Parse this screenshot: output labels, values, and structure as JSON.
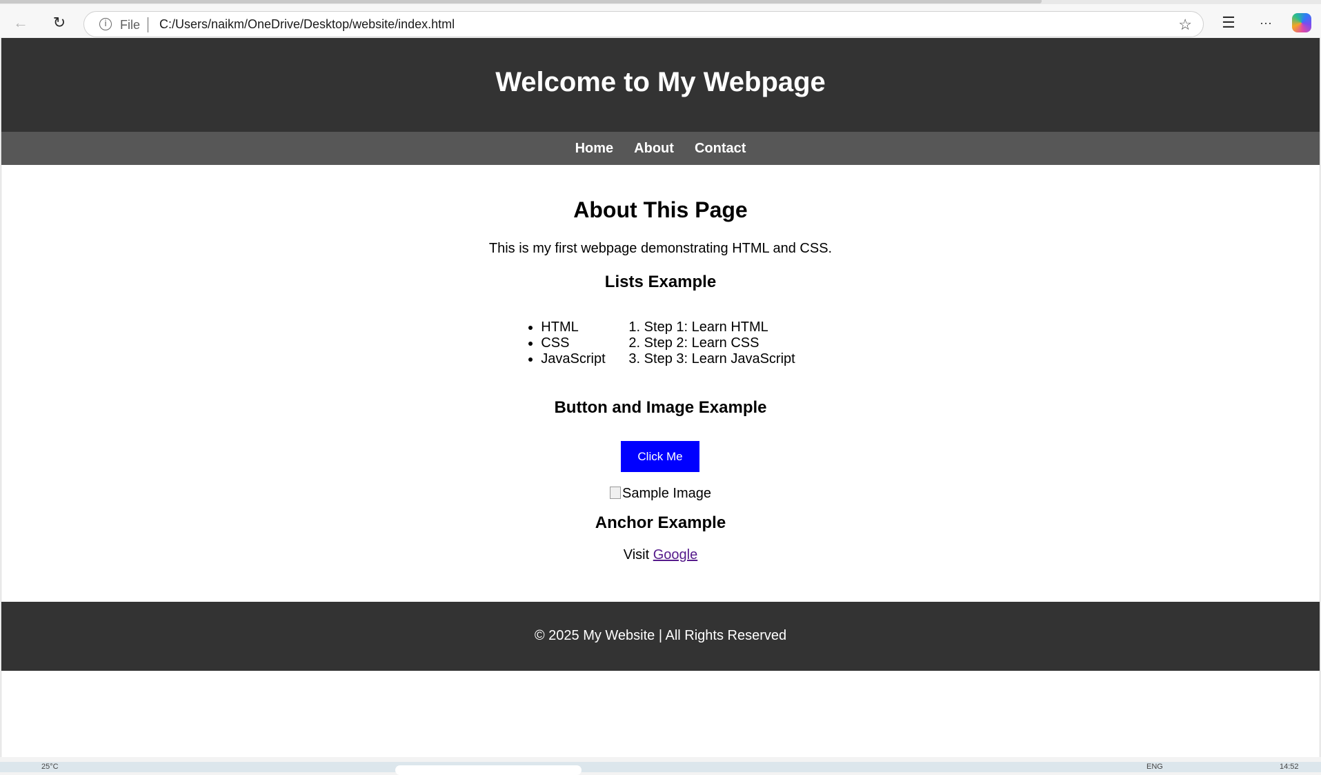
{
  "browser": {
    "address_scheme": "File",
    "address_url": "C:/Users/naikm/OneDrive/Desktop/website/index.html",
    "info_icon_char": "i",
    "back_icon": "←",
    "refresh_icon": "↻",
    "star_icon": "☆",
    "favorites_icon": "☰",
    "more_icon": "···"
  },
  "page": {
    "header_title": "Welcome to My Webpage",
    "nav": [
      {
        "label": "Home"
      },
      {
        "label": "About"
      },
      {
        "label": "Contact"
      }
    ],
    "about_heading": "About This Page",
    "intro_text": "This is my first webpage demonstrating HTML and CSS.",
    "lists_heading": "Lists Example",
    "unordered_list": [
      "HTML",
      "CSS",
      "JavaScript"
    ],
    "ordered_list": [
      "Step 1: Learn HTML",
      "Step 2: Learn CSS",
      "Step 3: Learn JavaScript"
    ],
    "button_image_heading": "Button and Image Example",
    "button_label": "Click Me",
    "image_alt": "Sample Image",
    "anchor_heading": "Anchor Example",
    "visit_prefix": "Visit ",
    "visit_link": "Google",
    "footer_text": "© 2025 My Website | All Rights Reserved"
  },
  "taskbar": {
    "left_text": "25°C",
    "lang": "ENG",
    "time": "14:52"
  },
  "colors": {
    "header_bg": "#333333",
    "nav_bg": "#575757",
    "button_bg": "#0000ff",
    "link_visited": "#551a8b"
  }
}
